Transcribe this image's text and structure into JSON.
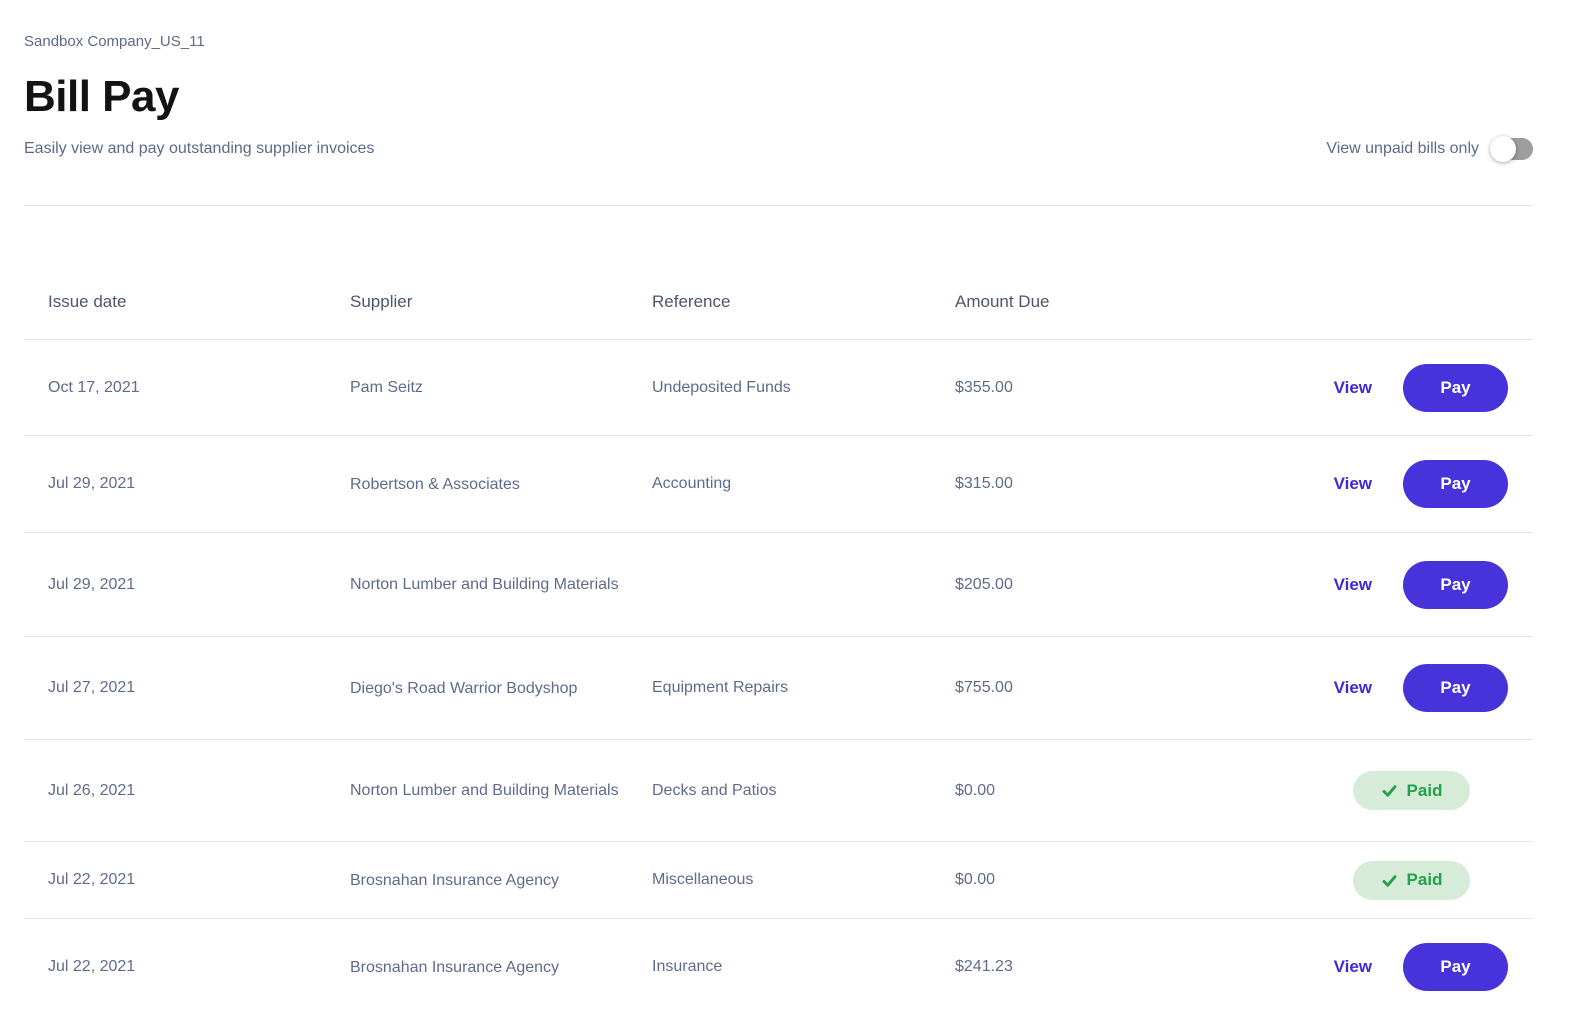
{
  "page": {
    "breadcrumb": "Sandbox Company_US_11",
    "title": "Bill Pay",
    "subtitle": "Easily view and pay outstanding supplier invoices",
    "toggle_label": "View unpaid bills only",
    "toggle_state": "off"
  },
  "table": {
    "headers": {
      "issue_date": "Issue date",
      "supplier": "Supplier",
      "reference": "Reference",
      "amount_due": "Amount Due"
    },
    "actions": {
      "view_label": "View",
      "pay_label": "Pay",
      "paid_label": "Paid",
      "paid_icon": "check-icon"
    },
    "rows": [
      {
        "issue_date": "Oct 17, 2021",
        "supplier": "Pam Seitz",
        "reference": "Undeposited Funds",
        "amount_due": "$355.00",
        "status": "unpaid"
      },
      {
        "issue_date": "Jul 29, 2021",
        "supplier": "Robertson & Associates",
        "reference": "Accounting",
        "amount_due": "$315.00",
        "status": "unpaid"
      },
      {
        "issue_date": "Jul 29, 2021",
        "supplier": "Norton Lumber and Building Materials",
        "reference": "",
        "amount_due": "$205.00",
        "status": "unpaid"
      },
      {
        "issue_date": "Jul 27, 2021",
        "supplier": "Diego's Road Warrior Bodyshop",
        "reference": "Equipment Repairs",
        "amount_due": "$755.00",
        "status": "unpaid"
      },
      {
        "issue_date": "Jul 26, 2021",
        "supplier": "Norton Lumber and Building Materials",
        "reference": "Decks and Patios",
        "amount_due": "$0.00",
        "status": "paid"
      },
      {
        "issue_date": "Jul 22, 2021",
        "supplier": "Brosnahan Insurance Agency",
        "reference": "Miscellaneous",
        "amount_due": "$0.00",
        "status": "paid"
      },
      {
        "issue_date": "Jul 22, 2021",
        "supplier": "Brosnahan Insurance Agency",
        "reference": "Insurance",
        "amount_due": "$241.23",
        "status": "unpaid"
      }
    ]
  },
  "colors": {
    "accent": "#4733d9",
    "accent_dark": "#3d2bd2",
    "paid_bg": "#d6ebd8",
    "paid_text": "#21a24b",
    "toggle_track": "#9d9d9d",
    "divider": "#e6e6e6",
    "text_muted": "#5b6b89",
    "text_cell": "#5d6c8c",
    "text_header": "#4c566c",
    "title_color": "#131313"
  }
}
